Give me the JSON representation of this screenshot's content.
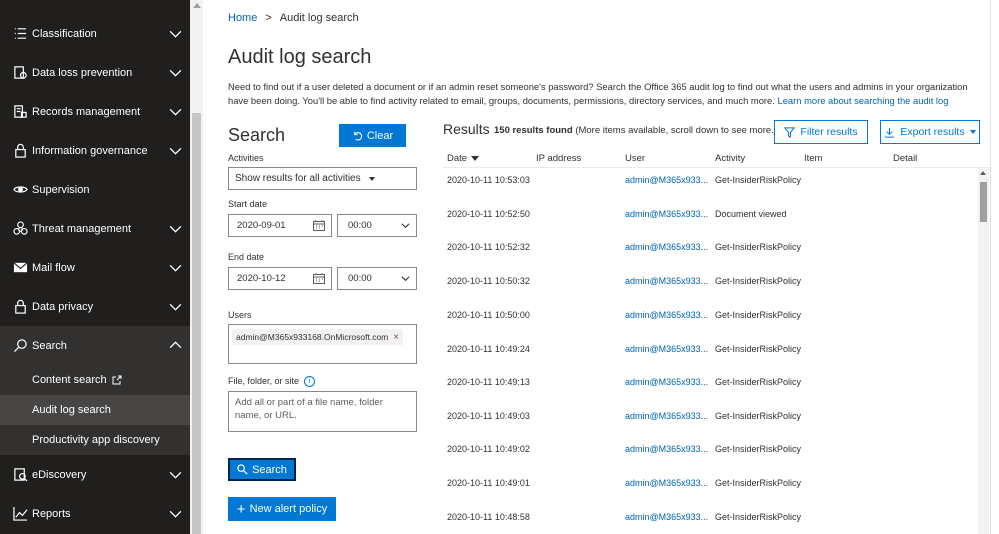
{
  "sidebar": {
    "items": [
      {
        "id": "classification",
        "label": "Classification",
        "icon": "list-icon",
        "chevron": "down"
      },
      {
        "id": "data-loss-prevention",
        "label": "Data loss prevention",
        "icon": "dlp-icon",
        "chevron": "down"
      },
      {
        "id": "records-management",
        "label": "Records management",
        "icon": "records-icon",
        "chevron": "down"
      },
      {
        "id": "information-governance",
        "label": "Information governance",
        "icon": "lock-icon",
        "chevron": "down"
      },
      {
        "id": "supervision",
        "label": "Supervision",
        "icon": "eye-icon",
        "chevron": ""
      },
      {
        "id": "threat-management",
        "label": "Threat management",
        "icon": "biohazard-icon",
        "chevron": "down"
      },
      {
        "id": "mail-flow",
        "label": "Mail flow",
        "icon": "mail-icon",
        "chevron": "down"
      },
      {
        "id": "data-privacy",
        "label": "Data privacy",
        "icon": "lock-icon",
        "chevron": "down"
      },
      {
        "id": "search",
        "label": "Search",
        "icon": "search-icon",
        "chevron": "up",
        "active": true
      }
    ],
    "search_sub": [
      {
        "label": "Content search",
        "external": true
      },
      {
        "label": "Audit log search",
        "selected": true
      },
      {
        "label": "Productivity app discovery"
      }
    ],
    "bottom_items": [
      {
        "id": "ediscovery",
        "label": "eDiscovery",
        "icon": "ediscovery-icon",
        "chevron": "down"
      },
      {
        "id": "reports",
        "label": "Reports",
        "icon": "chart-icon",
        "chevron": "down"
      }
    ]
  },
  "breadcrumb": {
    "home": "Home",
    "separator": ">",
    "current": "Audit log search"
  },
  "page": {
    "title": "Audit log search",
    "description": "Need to find out if a user deleted a document or if an admin reset someone's password? Search the Office 365 audit log to find out what the users and admins in your organization have been doing. You'll be able to find activity related to email, groups, documents, permissions, directory services, and much more.",
    "learn_more": "Learn more about searching the audit log"
  },
  "search": {
    "title": "Search",
    "clear_label": "Clear",
    "activities_label": "Activities",
    "activities_value": "Show results for all activities",
    "start_date_label": "Start date",
    "start_date": "2020-09-01",
    "start_time": "00:00",
    "end_date_label": "End date",
    "end_date": "2020-10-12",
    "end_time": "00:00",
    "users_label": "Users",
    "user_chip": "admin@M365x933168.OnMicrosoft.com",
    "file_label": "File, folder, or site",
    "file_placeholder": "Add all or part of a file name, folder name, or URL.",
    "search_button": "Search",
    "new_alert_button": "New alert policy"
  },
  "results": {
    "title": "Results",
    "count": "150 results found",
    "count_note": "(More items available, scroll down to see more.)",
    "filter_button": "Filter results",
    "export_button": "Export results",
    "columns": [
      "Date",
      "IP address",
      "User",
      "Activity",
      "Item",
      "Detail"
    ],
    "rows": [
      {
        "date": "2020-10-11 10:53:03",
        "ip": "",
        "user": "admin@M365x933...",
        "activity": "Get-InsiderRiskPolicy"
      },
      {
        "date": "2020-10-11 10:52:50",
        "ip": "",
        "user": "admin@M365x933...",
        "activity": "Document viewed"
      },
      {
        "date": "2020-10-11 10:52:32",
        "ip": "",
        "user": "admin@M365x933...",
        "activity": "Get-InsiderRiskPolicy"
      },
      {
        "date": "2020-10-11 10:50:32",
        "ip": "",
        "user": "admin@M365x933...",
        "activity": "Get-InsiderRiskPolicy"
      },
      {
        "date": "2020-10-11 10:50:00",
        "ip": "",
        "user": "admin@M365x933...",
        "activity": "Get-InsiderRiskPolicy"
      },
      {
        "date": "2020-10-11 10:49:24",
        "ip": "",
        "user": "admin@M365x933...",
        "activity": "Get-InsiderRiskPolicy"
      },
      {
        "date": "2020-10-11 10:49:13",
        "ip": "",
        "user": "admin@M365x933...",
        "activity": "Get-InsiderRiskPolicy"
      },
      {
        "date": "2020-10-11 10:49:03",
        "ip": "",
        "user": "admin@M365x933...",
        "activity": "Get-InsiderRiskPolicy"
      },
      {
        "date": "2020-10-11 10:49:02",
        "ip": "",
        "user": "admin@M365x933...",
        "activity": "Get-InsiderRiskPolicy"
      },
      {
        "date": "2020-10-11 10:49:01",
        "ip": "",
        "user": "admin@M365x933...",
        "activity": "Get-InsiderRiskPolicy"
      },
      {
        "date": "2020-10-11 10:48:58",
        "ip": "",
        "user": "admin@M365x933...",
        "activity": "Get-InsiderRiskPolicy"
      }
    ]
  },
  "colors": {
    "accent": "#0078d4",
    "link": "#0063b1",
    "sidebar_bg": "#201f1e",
    "sidebar_active": "#323130",
    "sidebar_selected": "#484644"
  }
}
